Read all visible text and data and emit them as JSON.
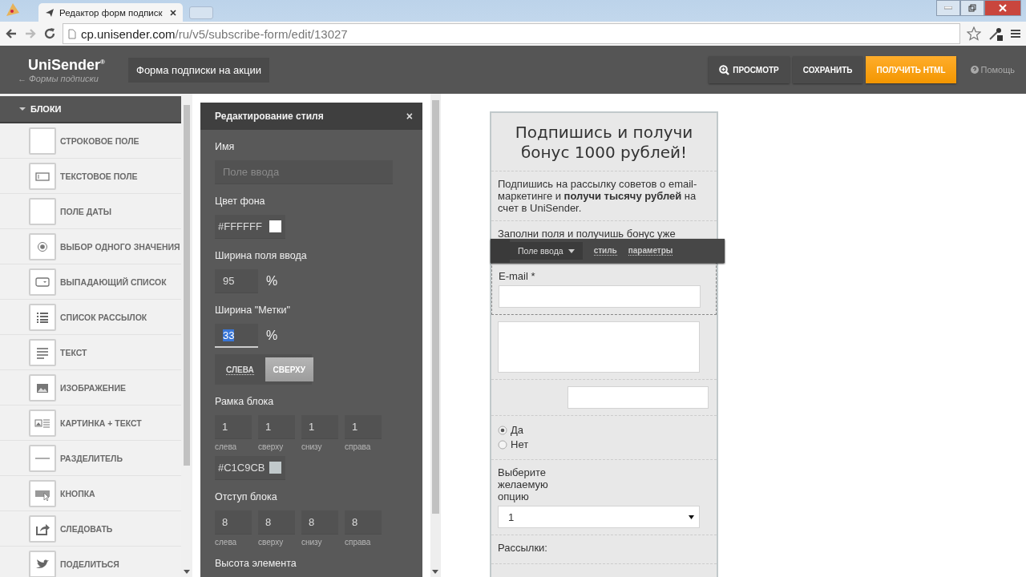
{
  "browser": {
    "tab_title": "Редактор форм подписк",
    "url_host": "cp.unisender.com",
    "url_path": "/ru/v5/subscribe-form/edit/13027"
  },
  "header": {
    "logo": "UniSender$^{®}$",
    "back_link": "← Формы подписки",
    "form_name": "Форма подписки на акции",
    "buttons": [
      {
        "label": "ПРОСМОТР",
        "kind": "preview"
      },
      {
        "label": "СОХРАНИТЬ",
        "kind": "plain"
      },
      {
        "label": "ПОЛУЧИТЬ HTML",
        "kind": "primary"
      }
    ],
    "help": "Помощь"
  },
  "sidebar": {
    "section": "БЛОКИ",
    "expanded": true,
    "items": [
      {
        "label": "СТРОКОВОЕ ПОЛЕ",
        "kind": "blank"
      },
      {
        "label": "ТЕКСТОВОЕ ПОЛЕ",
        "kind": "input"
      },
      {
        "label": "ПОЛЕ ДАТЫ",
        "kind": "blank"
      },
      {
        "label": "ВЫБОР ОДНОГО ЗНАЧЕНИЯ",
        "kind": "radio"
      },
      {
        "label": "ВЫПАДАЮЩИЙ СПИСОК",
        "kind": "dropdown"
      },
      {
        "label": "СПИСОК РАССЫЛОК",
        "kind": "list"
      },
      {
        "label": "ТЕКСТ",
        "kind": "text"
      },
      {
        "label": "ИЗОБРАЖЕНИЕ",
        "kind": "image"
      },
      {
        "label": "КАРТИНКА + ТЕКСТ",
        "kind": "image-text"
      },
      {
        "label": "РАЗДЕЛИТЕЛЬ",
        "kind": "divider"
      },
      {
        "label": "КНОПКА",
        "kind": "button"
      },
      {
        "label": "СЛЕДОВАТЬ",
        "kind": "share"
      },
      {
        "label": "ПОДЕЛИТЬСЯ",
        "kind": "bird"
      }
    ]
  },
  "style_panel": {
    "title": "Редактирование стиля",
    "close": "×",
    "fields": [
      {
        "kind": "text",
        "label": "Имя",
        "placeholder": "Поле ввода"
      },
      {
        "kind": "color",
        "label": "Цвет фона",
        "value": "#FFFFFF"
      },
      {
        "kind": "percent",
        "label": "Ширина поля ввода",
        "value": "95",
        "unit": "%",
        "focused": false
      },
      {
        "kind": "percent",
        "label": "Ширина \"Метки\"",
        "value": "33",
        "unit": "%",
        "focused": true
      },
      {
        "kind": "segmented",
        "options": [
          {
            "label": "СЛЕВА",
            "selected": false
          },
          {
            "label": "СВЕРХУ",
            "selected": true
          }
        ]
      },
      {
        "kind": "sides",
        "label": "Рамка блока",
        "values": [
          {
            "value": "1",
            "caption": "слева"
          },
          {
            "value": "1",
            "caption": "сверху"
          },
          {
            "value": "1",
            "caption": "снизу"
          },
          {
            "value": "1",
            "caption": "справа"
          }
        ]
      },
      {
        "kind": "color",
        "value": "#C1C9CB"
      },
      {
        "kind": "sides",
        "label": "Отступ блока",
        "values": [
          {
            "value": "8",
            "caption": "слева"
          },
          {
            "value": "8",
            "caption": "сверху"
          },
          {
            "value": "8",
            "caption": "снизу"
          },
          {
            "value": "8",
            "caption": "справа"
          }
        ]
      },
      {
        "kind": "heading",
        "label": "Высота элемента"
      }
    ]
  },
  "preview": {
    "heading": "Подпишись и получи бонус 1000 рублей!",
    "intro": "Подпишись на рассылку советов о email-маркетинге и **получи тысячу рублей** на счет в UniSender.",
    "note": "Заполни поля и получишь бонус уже",
    "toolbar": {
      "type_menu": "Поле ввода",
      "links": [
        "стиль",
        "параметры"
      ]
    },
    "blocks": [
      {
        "kind": "input",
        "label": "E-mail *",
        "selected": true
      },
      {
        "kind": "textarea",
        "selected": false
      },
      {
        "kind": "input-side",
        "selected": false
      },
      {
        "kind": "radio",
        "selected": false,
        "options": [
          {
            "label": "Да",
            "selected": true
          },
          {
            "label": "Нет",
            "selected": false
          }
        ]
      },
      {
        "kind": "select",
        "label": "Выберите желаемую опцию",
        "value": "1",
        "selected": false
      },
      {
        "kind": "checklist",
        "label": "Рассылки:",
        "selected": false
      }
    ]
  }
}
